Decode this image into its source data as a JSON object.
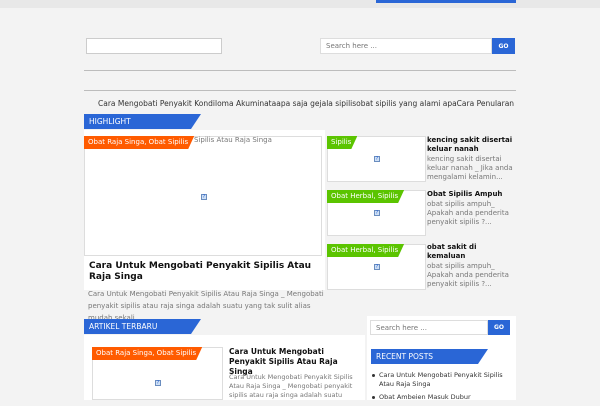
{
  "search": {
    "placeholder": "Search here ...",
    "button": "GO"
  },
  "nav": {
    "items": [
      "Cara Mengobati Penyakit Kondiloma Akuminata",
      "apa saja gejala sipilis",
      "obat sipilis yang alami apa",
      "Cara Penularan"
    ]
  },
  "highlight": {
    "title": "HIGHLIGHT",
    "main": {
      "category": "Obat Raja Singa, Obat Sipilis",
      "image_alt": "Sipilis Atau Raja Singa",
      "title": "Cara Untuk Mengobati Penyakit Sipilis Atau Raja Singa",
      "excerpt": "Cara Untuk Mengobati Penyakit Sipilis Atau Raja Singa _ Mengobati penyakit sipilis atau raja singa adalah suatu yang tak sulit alias mudah sekali..."
    },
    "side": [
      {
        "category": "Sipilis",
        "title": "kencing sakit disertai keluar nanah",
        "excerpt": "kencing sakit disertai keluar nanah _ Jika anda mengalami kelamin..."
      },
      {
        "category": "Obat Herbal, Sipilis",
        "title": "Obat Sipilis Ampuh",
        "excerpt": "obat sipilis ampuh_ Apakah anda penderita penyakit sipilis ?..."
      },
      {
        "category": "Obat Herbal, Sipilis",
        "title": "obat sakit di kemaluan",
        "excerpt": "obat sipilis ampuh_ Apakah anda penderita penyakit sipilis ?..."
      }
    ]
  },
  "latest": {
    "title": "ARTIKEL TERBARU",
    "item": {
      "category": "Obat Raja Singa, Obat Sipilis",
      "title": "Cara Untuk Mengobati Penyakit Sipilis Atau Raja Singa",
      "excerpt": "Cara Untuk Mengobati Penyakit Sipilis Atau Raja Singa _ Mengobati penyakit sipilis atau raja singa adalah suatu yang"
    }
  },
  "sidebar": {
    "search_placeholder": "Search here ...",
    "search_button": "GO",
    "recent_title": "RECENT POSTS",
    "recent": [
      "Cara Untuk Mengobati Penyakit Sipilis Atau Raja Singa",
      "Obat Ambeien Masuk Dubur"
    ]
  },
  "colors": {
    "accent": "#2a66d6",
    "orange": "#ff5b00",
    "green": "#5bc400"
  },
  "icons": {
    "broken_image": "broken-image-icon"
  }
}
